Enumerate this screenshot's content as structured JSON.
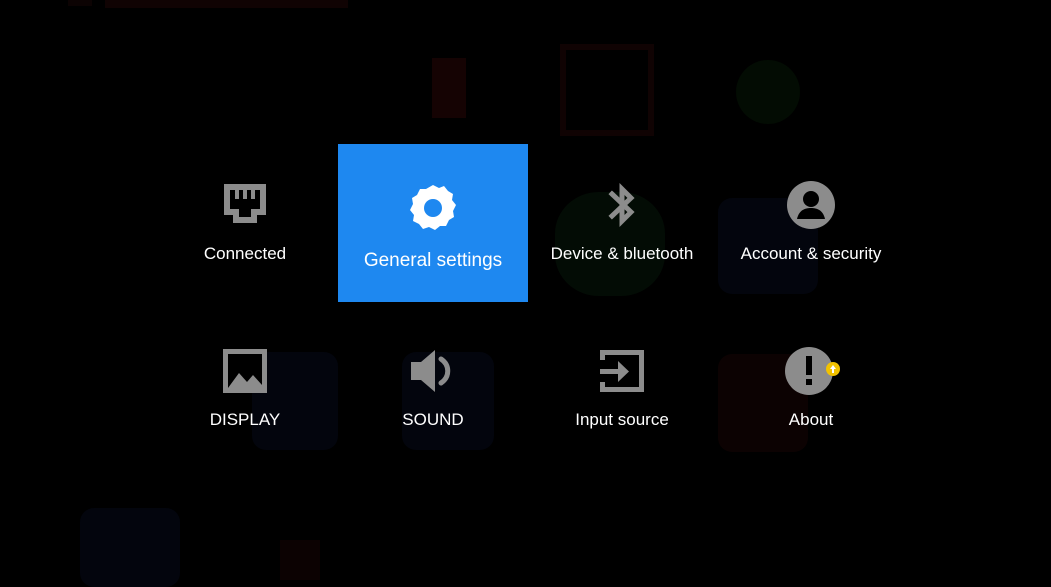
{
  "menu": {
    "items": [
      {
        "id": "connected",
        "label": "Connected",
        "icon": "ethernet-icon"
      },
      {
        "id": "general",
        "label": "General settings",
        "icon": "gear-icon",
        "selected": true
      },
      {
        "id": "device",
        "label": "Device & bluetooth",
        "icon": "bluetooth-icon"
      },
      {
        "id": "account",
        "label": "Account & security",
        "icon": "account-icon"
      },
      {
        "id": "display",
        "label": "DISPLAY",
        "icon": "image-icon"
      },
      {
        "id": "sound",
        "label": "SOUND",
        "icon": "speaker-icon"
      },
      {
        "id": "input",
        "label": "Input source",
        "icon": "input-source-icon"
      },
      {
        "id": "about",
        "label": "About",
        "icon": "info-alert-icon",
        "badge": "update-badge"
      }
    ]
  },
  "colors": {
    "background": "#000000",
    "selected_tile": "#1e88f0",
    "icon_gray": "#8c8c8c",
    "badge_yellow": "#f2c200"
  }
}
